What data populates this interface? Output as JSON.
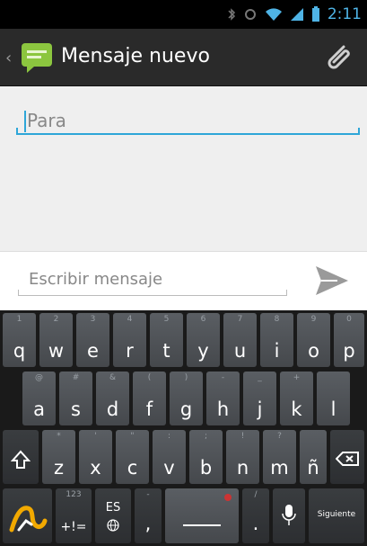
{
  "status_bar": {
    "time": "2:11"
  },
  "action_bar": {
    "title": "Mensaje nuevo"
  },
  "compose": {
    "to_placeholder": "Para"
  },
  "message": {
    "placeholder": "Escribir mensaje"
  },
  "keyboard": {
    "row1": [
      {
        "main": "q",
        "hint": "1"
      },
      {
        "main": "w",
        "hint": "2"
      },
      {
        "main": "e",
        "hint": "3"
      },
      {
        "main": "r",
        "hint": "4"
      },
      {
        "main": "t",
        "hint": "5"
      },
      {
        "main": "y",
        "hint": "6"
      },
      {
        "main": "u",
        "hint": "7"
      },
      {
        "main": "i",
        "hint": "8"
      },
      {
        "main": "o",
        "hint": "9"
      },
      {
        "main": "p",
        "hint": "0"
      }
    ],
    "row2": [
      {
        "main": "a",
        "hint": "@"
      },
      {
        "main": "s",
        "hint": "#"
      },
      {
        "main": "d",
        "hint": "&"
      },
      {
        "main": "f",
        "hint": "("
      },
      {
        "main": "g",
        "hint": ")"
      },
      {
        "main": "h",
        "hint": "-"
      },
      {
        "main": "j",
        "hint": "_"
      },
      {
        "main": "k",
        "hint": "+"
      },
      {
        "main": "l",
        "hint": ""
      }
    ],
    "row3": [
      {
        "main": "z",
        "hint": "*"
      },
      {
        "main": "x",
        "hint": "'"
      },
      {
        "main": "c",
        "hint": "\""
      },
      {
        "main": "v",
        "hint": ":"
      },
      {
        "main": "b",
        "hint": ";"
      },
      {
        "main": "n",
        "hint": "!"
      },
      {
        "main": "m",
        "hint": "?"
      },
      {
        "main": "ñ",
        "hint": ""
      }
    ],
    "symbols_label": "+!=",
    "symbols_hint": "123",
    "lang_label": "ES",
    "comma_label": ",",
    "period_label": ".",
    "next_label": "Siguiente"
  },
  "colors": {
    "accent": "#2ea6d8",
    "action_bar": "#2a2a2a",
    "key": "#4f5357"
  },
  "icons": [
    "messaging-app-icon",
    "attach-icon",
    "send-icon",
    "shift-icon",
    "backspace-icon",
    "swype-icon",
    "globe-icon",
    "mic-icon"
  ]
}
